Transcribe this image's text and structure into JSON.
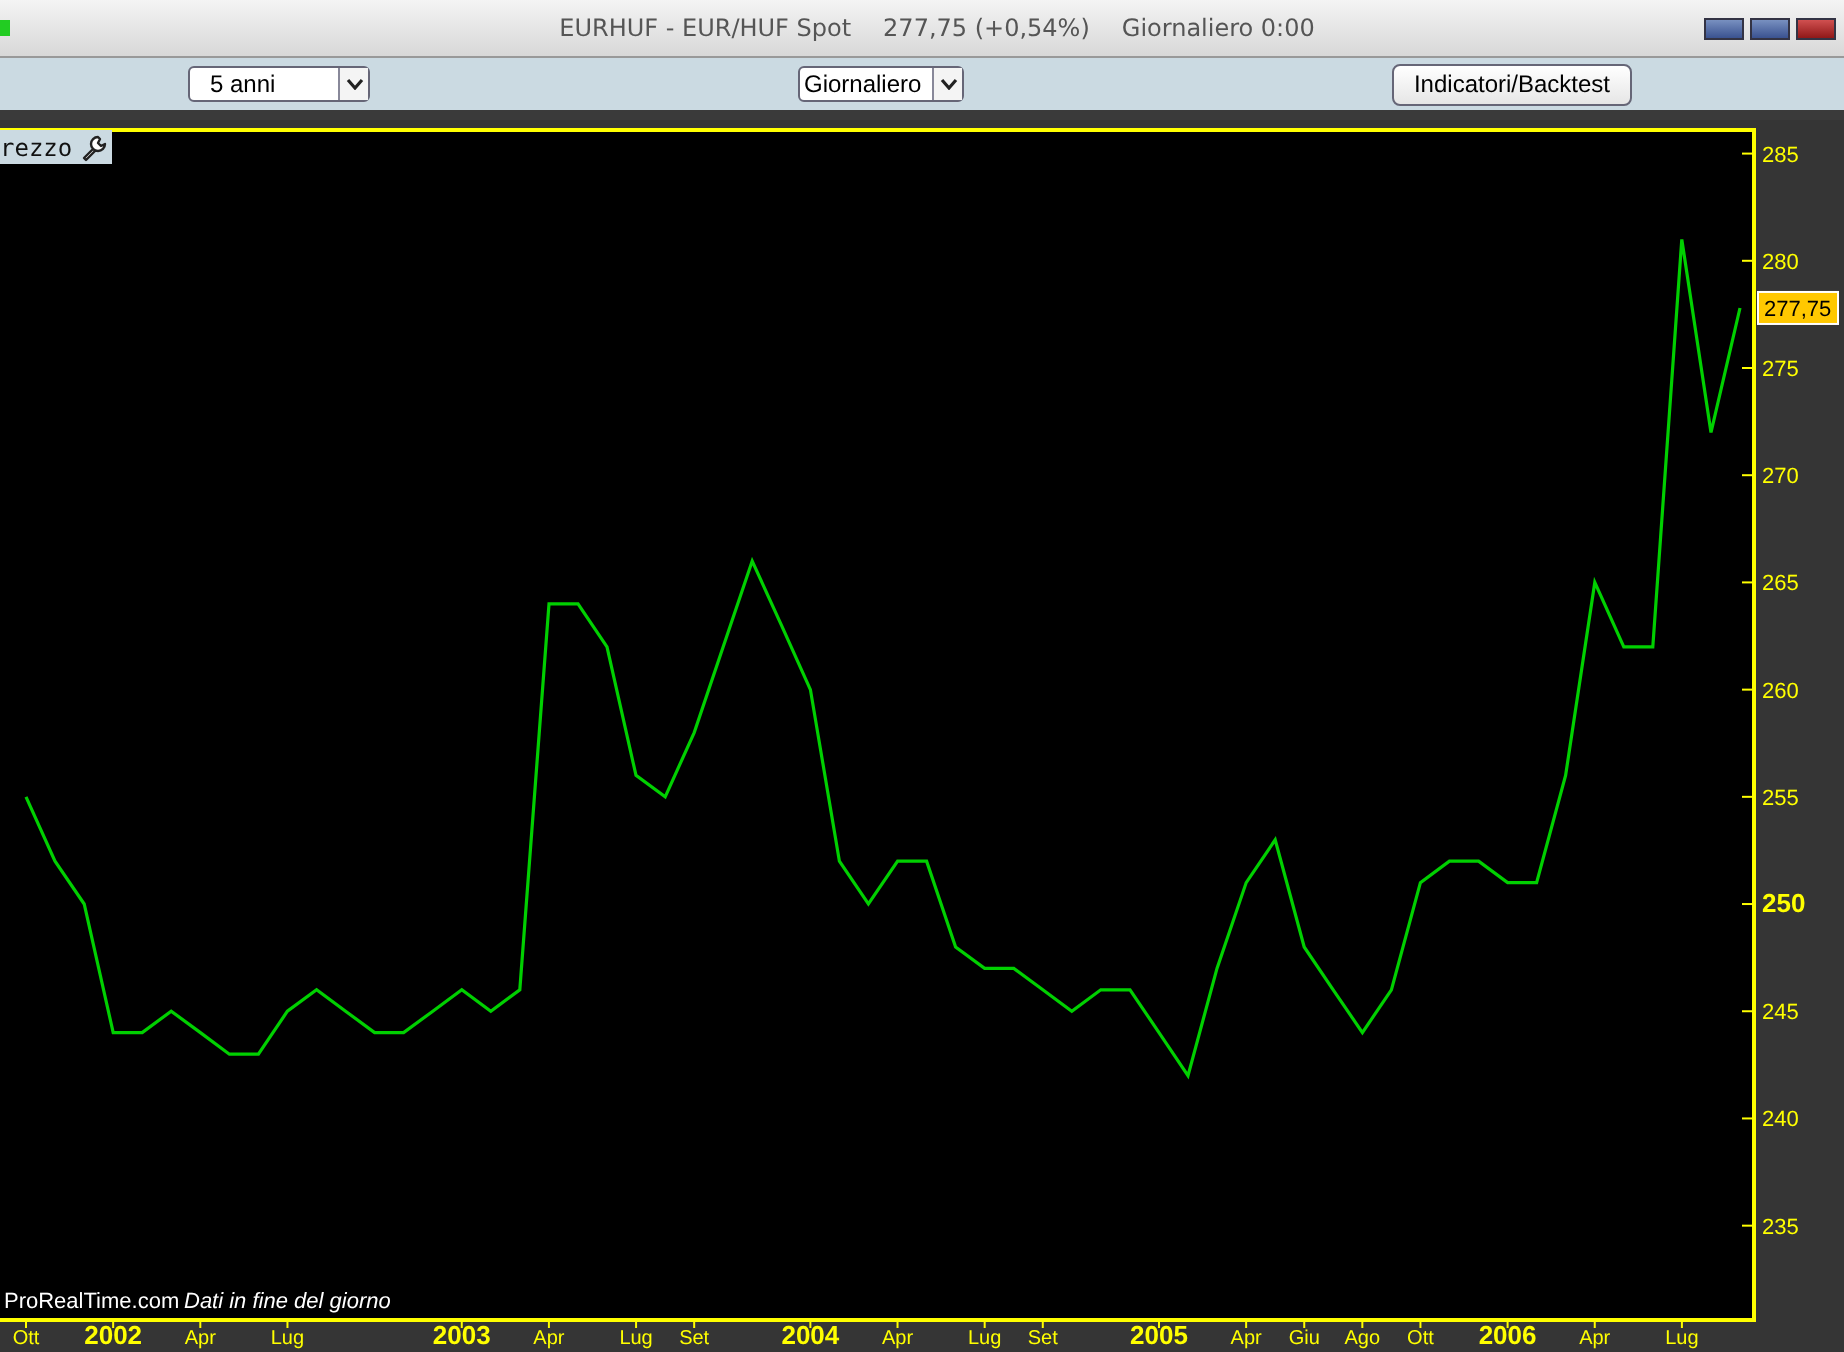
{
  "window": {
    "title": "EURHUF - EUR/HUF Spot",
    "price": "277,75 (+0,54%)",
    "period": "Giornaliero  0:00"
  },
  "toolbar": {
    "range_select": "5 anni",
    "period_select": "Giornaliero",
    "indicators_button": "Indicatori/Backtest"
  },
  "chart": {
    "legend_label": "rezzo",
    "source": "ProRealTime.com",
    "note": "Dati in fine del giorno",
    "last_price": "277,75",
    "chart_data": {
      "type": "line",
      "categories": [
        "Ott",
        null,
        null,
        "2002",
        null,
        null,
        "Apr",
        null,
        null,
        "Lug",
        null,
        null,
        null,
        null,
        null,
        "2003",
        null,
        null,
        "Apr",
        null,
        null,
        "Lug",
        null,
        "Set",
        null,
        null,
        null,
        "2004",
        null,
        null,
        "Apr",
        null,
        null,
        "Lug",
        null,
        "Set",
        null,
        null,
        null,
        "2005",
        null,
        null,
        "Apr",
        null,
        "Giu",
        null,
        "Ago",
        null,
        "Ott",
        null,
        null,
        "2006",
        null,
        null,
        "Apr",
        null,
        null,
        "Lug",
        null,
        null
      ],
      "series": [
        {
          "color": "#00d000",
          "values": [
            255,
            252,
            250,
            244,
            244,
            245,
            244,
            243,
            243,
            245,
            246,
            245,
            244,
            244,
            245,
            246,
            245,
            246,
            264,
            264,
            262,
            256,
            255,
            258,
            262,
            266,
            263,
            260,
            252,
            250,
            252,
            252,
            248,
            247,
            247,
            246,
            245,
            246,
            246,
            244,
            242,
            247,
            251,
            253,
            248,
            246,
            244,
            246,
            251,
            252,
            252,
            251,
            251,
            256,
            265,
            262,
            262,
            281,
            272,
            277.8
          ]
        }
      ],
      "ylim": [
        230.6,
        286.1
      ],
      "yticks": [
        235,
        240,
        245,
        250,
        255,
        260,
        265,
        270,
        275,
        280,
        285
      ]
    }
  }
}
